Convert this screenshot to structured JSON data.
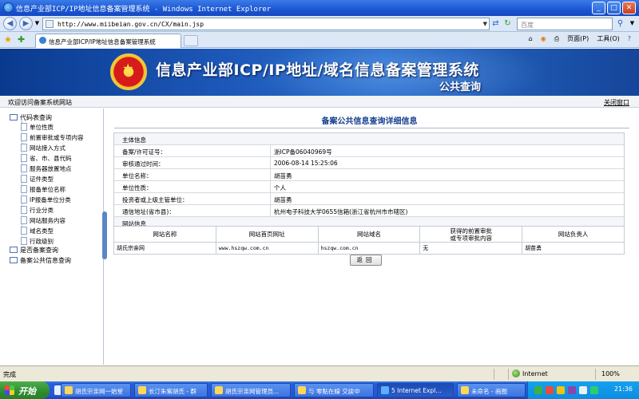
{
  "window": {
    "title": "信息产业部ICP/IP地址信息备案管理系统 - Windows Internet Explorer",
    "minimize": "_",
    "maximize": "□",
    "close": "✕"
  },
  "addressbar": {
    "url": "http://www.miibeian.gov.cn/CX/main.jsp",
    "search_placeholder": "百度"
  },
  "tab": {
    "label": "信息产业部ICP/IP地址信息备案管理系统"
  },
  "commandbar": {
    "page": "页面(P)",
    "tools": "工具(O)"
  },
  "banner": {
    "title": "信息产业部ICP/IP地址/域名信息备案管理系统",
    "subtitle": "公共查询"
  },
  "welcome": {
    "left": "欢迎访问备案系统网站",
    "right": "关闭窗口"
  },
  "sidebar": {
    "group1": "代码表查询",
    "items": [
      "单位性质",
      "前置审批或专项内容",
      "网站接入方式",
      "省、市、县代码",
      "服务器放置地点",
      "证件类型",
      "报备单位名称",
      "IP报备单位分类",
      "行业分类",
      "网站服务内容",
      "域名类型",
      "行政级别"
    ],
    "group2": "是否备案查询",
    "group3": "备案公共信息查询"
  },
  "main": {
    "page_title": "备案公共信息查询详细信息",
    "section_subject": "主体信息",
    "rows": [
      {
        "label": "备案/许可证号：",
        "value": "浙ICP备06040969号"
      },
      {
        "label": "审核通过时间：",
        "value": "2006-08-14 15:25:06"
      },
      {
        "label": "单位名称：",
        "value": "胡苗勇"
      },
      {
        "label": "单位性质：",
        "value": "个人"
      },
      {
        "label": "投资者或上级主管单位：",
        "value": "胡苗勇"
      },
      {
        "label": "通信地址(省市县)：",
        "value": "杭州电子科技大学0655信箱(浙江省杭州市市辖区)"
      }
    ],
    "section_site": "网站信息",
    "site_headers": [
      "网站名称",
      "网站首页网址",
      "网站域名",
      "获得的前置审批\n或专项审批内容",
      "网站负责人"
    ],
    "site_rows": [
      [
        "胡氏宗亲网",
        "www.hszqw.com.cn",
        "hszqw.com.cn",
        "无",
        "胡苗勇"
      ]
    ],
    "back_button": "返回"
  },
  "statusbar": {
    "text": "完成",
    "zone": "Internet",
    "zoom": "100%"
  },
  "taskbar": {
    "start": "开始",
    "tasks": [
      "胡氏宗亲网一始堂",
      "长汀朱紫胡氏 - 群",
      "胡氏宗亲网管理员...",
      "与 零點在線 交談中",
      "5 Internet Expl...",
      "未命名 - 画图"
    ],
    "clock": "21:36"
  }
}
